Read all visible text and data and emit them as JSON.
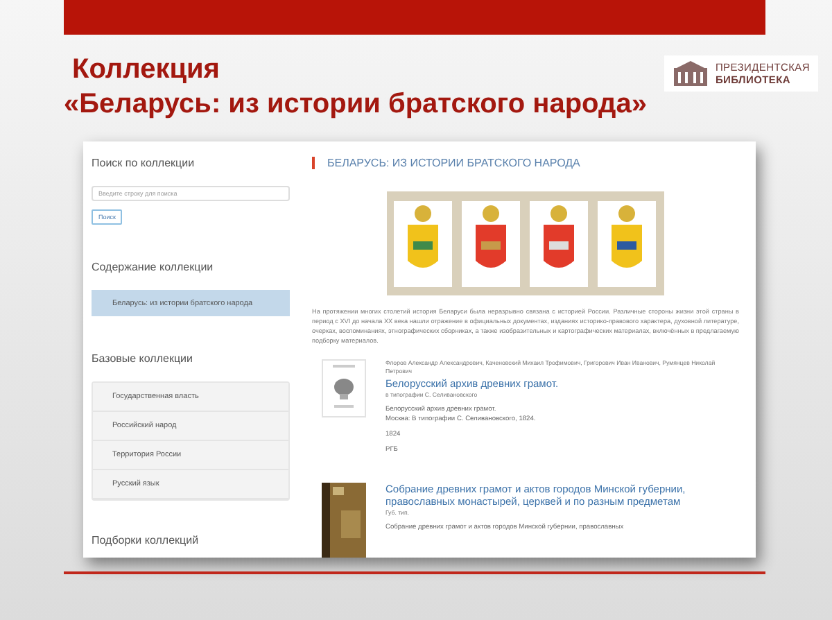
{
  "slide": {
    "title_lines": [
      "Коллекция",
      "«Беларусь: из истории братского народа»"
    ],
    "logo": [
      "ПРЕЗИДЕНТСКАЯ",
      "БИБЛИОТЕКА"
    ]
  },
  "sidebar": {
    "search": {
      "heading": "Поиск по коллекции",
      "placeholder": "Введите строку для поиска",
      "button": "Поиск"
    },
    "sections": [
      {
        "heading": "Содержание коллекции",
        "items": [
          {
            "label": "Беларусь: из истории братского народа",
            "selected": true
          }
        ]
      },
      {
        "heading": "Базовые коллекции",
        "items": [
          {
            "label": "Государственная власть",
            "selected": false
          },
          {
            "label": "Российский народ",
            "selected": false
          },
          {
            "label": "Территория России",
            "selected": false
          },
          {
            "label": "Русский язык",
            "selected": false
          }
        ]
      },
      {
        "heading": "Подборки коллекций"
      }
    ]
  },
  "main": {
    "heading": "БЕЛАРУСЬ: ИЗ ИСТОРИИ БРАТСКОГО НАРОДА",
    "intro": "На протяжении многих столетий история Беларуси была неразрывно связана с историей России. Различные стороны жизни этой страны в период с XVI до начала XX века нашли отражение в официальных документах, изданиях историко-правового характера, духовной литературе, очерках, воспоминаниях, этнографических сборниках, а также изобразительных и картографических материалах, включённых в предлагаемую подборку материалов.",
    "records": [
      {
        "kind": "engraving",
        "authors": "Флоров Александр Александрович, Каченовский Михаил Трофимович, Григорович Иван Иванович, Румянцев Николай Петрович",
        "title": "Белорусский архив древних грамот.",
        "publisher": "в типографии С. Селивановского",
        "details": [
          "Белорусский архив древних грамот.",
          "Москва: В типографии С. Селивановского, 1824."
        ],
        "year": "1824",
        "source": "РГБ"
      },
      {
        "kind": "leather",
        "title": "Собрание древних грамот и актов городов Минской губернии, православных монастырей, церквей и по разным предметам",
        "publisher": "Губ. тип.",
        "details": [
          "Собрание древних грамот и актов городов Минской губернии, православных"
        ]
      }
    ]
  }
}
